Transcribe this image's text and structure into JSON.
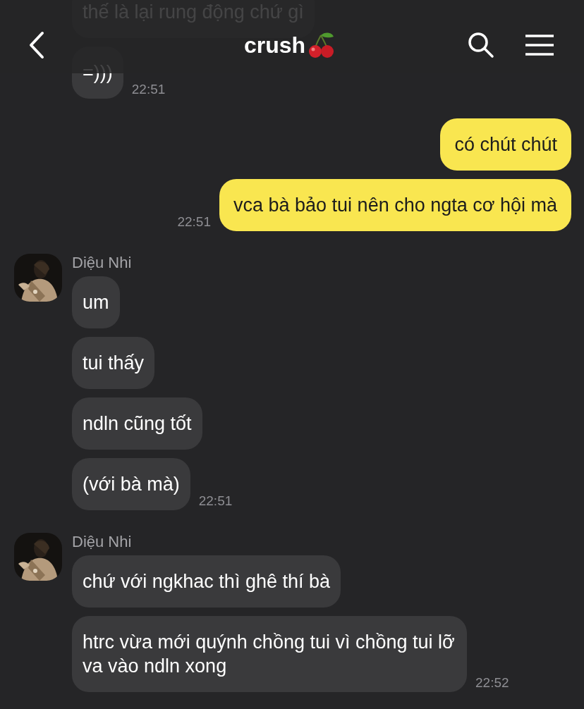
{
  "header": {
    "title": "crush"
  },
  "groups": [
    {
      "kind": "incoming",
      "bubbles": [
        "thế là lại rung động chứ gì",
        "=)))"
      ],
      "time": "22:51"
    },
    {
      "kind": "outgoing",
      "bubbles": [
        "có chút chút",
        "vca bà bảo tui nên cho ngta cơ hội mà"
      ],
      "time": "22:51"
    },
    {
      "kind": "incoming",
      "name": "Diệu Nhi",
      "bubbles": [
        "um",
        "tui thấy",
        "ndln cũng tốt",
        "(với bà mà)"
      ],
      "time": "22:51"
    },
    {
      "kind": "incoming",
      "name": "Diệu Nhi",
      "bubbles": [
        "chứ với ngkhac thì ghê thí bà",
        "htrc vừa mới quýnh chồng tui vì chồng tui lỡ va vào ndln xong"
      ],
      "time": "22:52"
    }
  ]
}
